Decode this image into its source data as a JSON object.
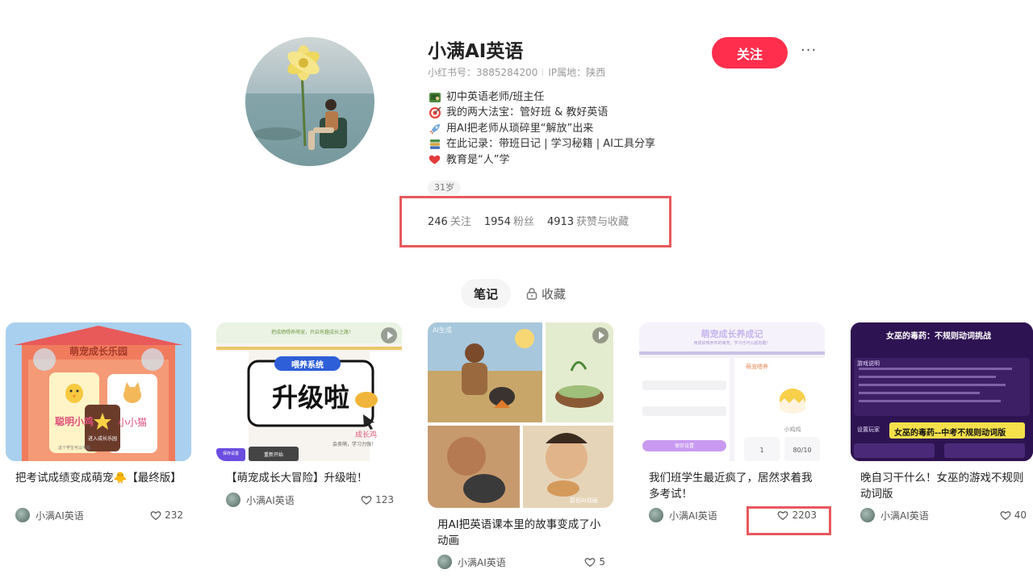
{
  "profile": {
    "name": "小满AI英语",
    "id_label": "小红书号：3885284200",
    "ip_label": "IP属地：陕西",
    "follow_label": "关注",
    "more_label": "···",
    "bio": [
      {
        "icon": "teacher-icon",
        "text": "初中英语老师/班主任"
      },
      {
        "icon": "target-icon",
        "text": "我的两大法宝：管好班 & 教好英语"
      },
      {
        "icon": "rocket-icon",
        "text": "用AI把老师从琐碎里“解放”出来"
      },
      {
        "icon": "books-icon",
        "text": "在此记录：带班日记 | 学习秘籍 | AI工具分享"
      },
      {
        "icon": "heart-icon",
        "text": "教育是“人”学"
      }
    ],
    "age_tag": "31岁",
    "stats": [
      {
        "value": "246",
        "label": "关注"
      },
      {
        "value": "1954",
        "label": "粉丝"
      },
      {
        "value": "4913",
        "label": "获赞与收藏"
      }
    ]
  },
  "tabs": {
    "notes": "笔记",
    "favorites": "收藏"
  },
  "notes": [
    {
      "title": "把考试成绩变成萌宠🐥【最终版】",
      "author": "小满AI英语",
      "likes": "232",
      "image": {
        "heading": "萌宠成长乐园",
        "left_pet": "聪明小鸡",
        "right_pet": "小小猫",
        "button": "进入成长乐园",
        "small_text": "这个学生可以不错"
      }
    },
    {
      "title": "【萌宠成长大冒险】升级啦！",
      "author": "小满AI英语",
      "likes": "123",
      "image": {
        "top_text": "把成绩喂养萌宠，开启有趣成长之路！",
        "badge": "喂养系统",
        "headline": "升级啦",
        "side_label": "成长鸡",
        "small_text": "会卖萌，学习力强！",
        "left_btn": "保存设置",
        "right_btn": "重新开始"
      }
    },
    {
      "title": "用AI把英语课本里的故事变成了小动画",
      "author": "小满AI英语",
      "likes": "5",
      "image": {
        "corner": "AI生成",
        "watermark": "原创AI动画"
      }
    },
    {
      "title": "我们班学生最近疯了，居然求着我多考试！",
      "author": "小满AI英语",
      "likes": "2203",
      "image": {
        "heading": "萌宠成长养成记",
        "subtitle": "用成绩喂养你的萌宠，学习也可以超有趣！",
        "panel": "萌宠喂养",
        "pet_name": "小鸡鸡",
        "button": "保存设置",
        "num_left": "1",
        "num_right": "80/10"
      }
    },
    {
      "title": "晚自习干什么！女巫的游戏不规则动词版",
      "author": "小满AI英语",
      "likes": "40",
      "image": {
        "heading": "女巫的毒药：不规则动词挑战",
        "section": "游戏说明",
        "banner": "女巫的毒药--中考不规则动词版",
        "setup": "设置玩家"
      }
    }
  ],
  "colors": {
    "accent": "#ff2e4d",
    "highlight": "#e8585c"
  }
}
